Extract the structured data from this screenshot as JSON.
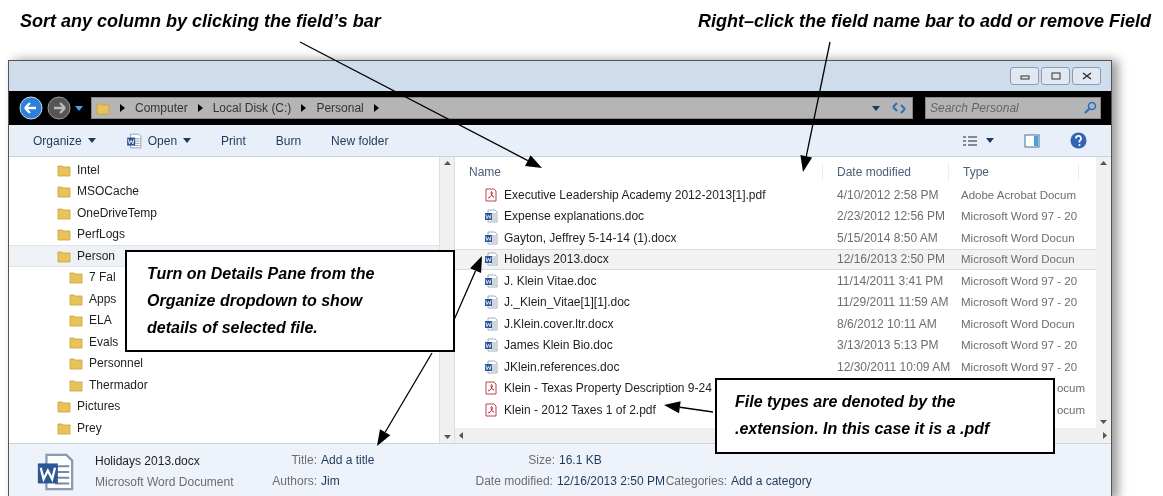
{
  "annotations": {
    "top": [
      {
        "text": "Sort any column by clicking the field’s bar"
      },
      {
        "text": "Right–click the field name bar to add or remove Field"
      }
    ],
    "callouts": [
      {
        "text": "Turn on Details Pane from the Organize dropdown to show details of selected file."
      },
      {
        "text": "File types are denoted by the .extension. In this case it is a .pdf"
      }
    ]
  },
  "address_bar": {
    "crumbs": [
      "Computer",
      "Local Disk (C:)",
      "Personal"
    ]
  },
  "search": {
    "placeholder": "Search Personal"
  },
  "toolbar": [
    {
      "label": "Organize",
      "kind": "dropdown"
    },
    {
      "label": "Open",
      "kind": "app-dropdown"
    },
    {
      "label": "Print",
      "kind": "plain"
    },
    {
      "label": "Burn",
      "kind": "plain"
    },
    {
      "label": "New folder",
      "kind": "plain"
    }
  ],
  "nav": [
    {
      "label": "Intel",
      "selected": false
    },
    {
      "label": "MSOCache",
      "selected": false
    },
    {
      "label": "OneDriveTemp",
      "selected": false
    },
    {
      "label": "PerfLogs",
      "selected": false
    },
    {
      "label": "Person",
      "selected": true,
      "children": [
        {
          "label": "7 Fal",
          "selected": false
        },
        {
          "label": "Apps",
          "selected": false
        },
        {
          "label": "ELA",
          "selected": false
        },
        {
          "label": "Evals",
          "selected": false
        },
        {
          "label": "Personnel",
          "selected": false
        },
        {
          "label": "Thermador",
          "selected": false
        }
      ]
    },
    {
      "label": "Pictures",
      "selected": false
    },
    {
      "label": "Prey",
      "selected": false
    }
  ],
  "files": {
    "columns": [
      "Name",
      "Date modified",
      "Type"
    ],
    "rows": [
      {
        "name": "Executive Leadership Academy 2012-2013[1].pdf",
        "date": "4/10/2012 2:58 PM",
        "type": "Adobe Acrobat Docum",
        "kind": "pdf",
        "selected": false
      },
      {
        "name": "Expense explanations.doc",
        "date": "2/23/2012 12:56 PM",
        "type": "Microsoft Word 97 - 20",
        "kind": "word",
        "selected": false
      },
      {
        "name": "Gayton, Jeffrey 5-14-14 (1).docx",
        "date": "5/15/2014 8:50 AM",
        "type": "Microsoft Word Docun",
        "kind": "word",
        "selected": false
      },
      {
        "name": "Holidays 2013.docx",
        "date": "12/16/2013 2:50 PM",
        "type": "Microsoft Word Docun",
        "kind": "word",
        "selected": true
      },
      {
        "name": "J. Klein Vitae.doc",
        "date": "11/14/2011 3:41 PM",
        "type": "Microsoft Word 97 - 20",
        "kind": "word",
        "selected": false
      },
      {
        "name": "J._Klein_Vitae[1][1].doc",
        "date": "11/29/2011 11:59 AM",
        "type": "Microsoft Word 97 - 20",
        "kind": "word",
        "selected": false
      },
      {
        "name": "J.Klein.cover.ltr.docx",
        "date": "8/6/2012 10:11 AM",
        "type": "Microsoft Word Docun",
        "kind": "word",
        "selected": false
      },
      {
        "name": "James Klein Bio.doc",
        "date": "3/13/2013 5:13 PM",
        "type": "Microsoft Word 97 - 20",
        "kind": "word",
        "selected": false
      },
      {
        "name": "JKlein.references.doc",
        "date": "12/30/2011 10:09 AM",
        "type": "Microsoft Word 97 - 20",
        "kind": "word",
        "selected": false
      },
      {
        "name": "Klein -  Texas Property Description 9-24",
        "type": "ocum",
        "kind": "pdf",
        "selected": false
      },
      {
        "name": "Klein - 2012 Taxes 1 of 2.pdf",
        "type": "ocum",
        "kind": "pdf",
        "selected": false
      }
    ]
  },
  "details": {
    "name": "Holidays 2013.docx",
    "type": "Microsoft Word Document",
    "columns": [
      [
        {
          "label": "Title:",
          "value": "Add a title"
        },
        {
          "label": "Authors:",
          "value": "Jim"
        }
      ],
      [
        {
          "label": "Size:",
          "value": "16.1 KB"
        },
        {
          "label": "Date modified:",
          "value": "12/16/2013 2:50 PM"
        }
      ],
      [
        {
          "label": "Categories:",
          "value": "Add a category"
        }
      ]
    ]
  }
}
